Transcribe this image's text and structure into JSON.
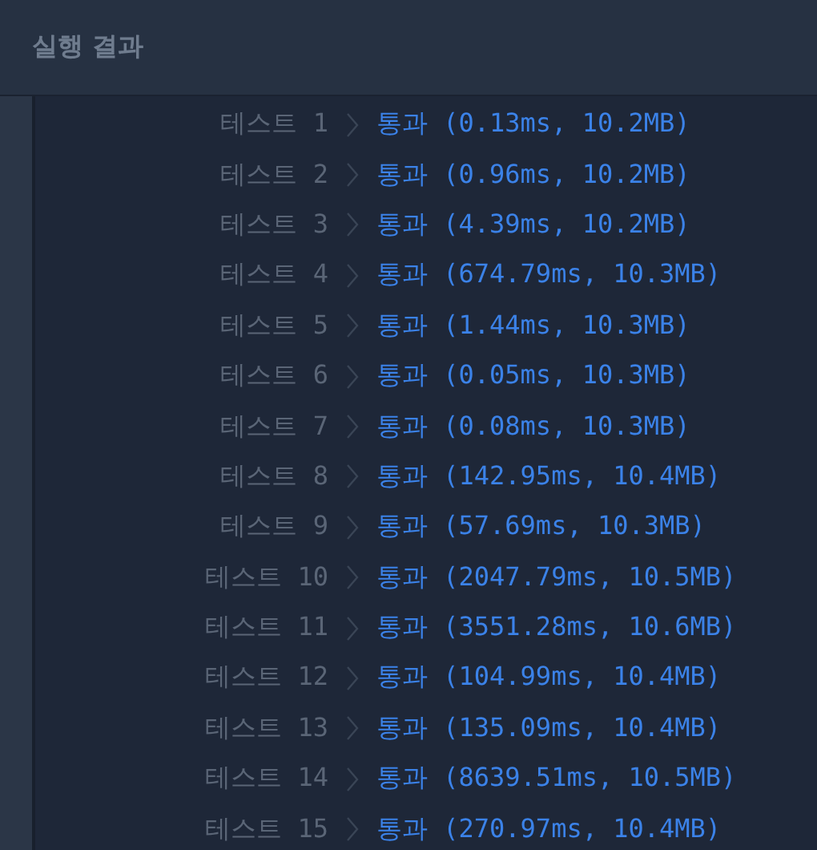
{
  "panel": {
    "title": "실행 결과"
  },
  "tests": [
    {
      "label": "테스트 1",
      "result": "통과 (0.13ms, 10.2MB)"
    },
    {
      "label": "테스트 2",
      "result": "통과 (0.96ms, 10.2MB)"
    },
    {
      "label": "테스트 3",
      "result": "통과 (4.39ms, 10.2MB)"
    },
    {
      "label": "테스트 4",
      "result": "통과 (674.79ms, 10.3MB)"
    },
    {
      "label": "테스트 5",
      "result": "통과 (1.44ms, 10.3MB)"
    },
    {
      "label": "테스트 6",
      "result": "통과 (0.05ms, 10.3MB)"
    },
    {
      "label": "테스트 7",
      "result": "통과 (0.08ms, 10.3MB)"
    },
    {
      "label": "테스트 8",
      "result": "통과 (142.95ms, 10.4MB)"
    },
    {
      "label": "테스트 9",
      "result": "통과 (57.69ms, 10.3MB)"
    },
    {
      "label": "테스트 10",
      "result": "통과 (2047.79ms, 10.5MB)"
    },
    {
      "label": "테스트 11",
      "result": "통과 (3551.28ms, 10.6MB)"
    },
    {
      "label": "테스트 12",
      "result": "통과 (104.99ms, 10.4MB)"
    },
    {
      "label": "테스트 13",
      "result": "통과 (135.09ms, 10.4MB)"
    },
    {
      "label": "테스트 14",
      "result": "통과 (8639.51ms, 10.5MB)"
    },
    {
      "label": "테스트 15",
      "result": "통과 (270.97ms, 10.4MB)"
    }
  ]
}
